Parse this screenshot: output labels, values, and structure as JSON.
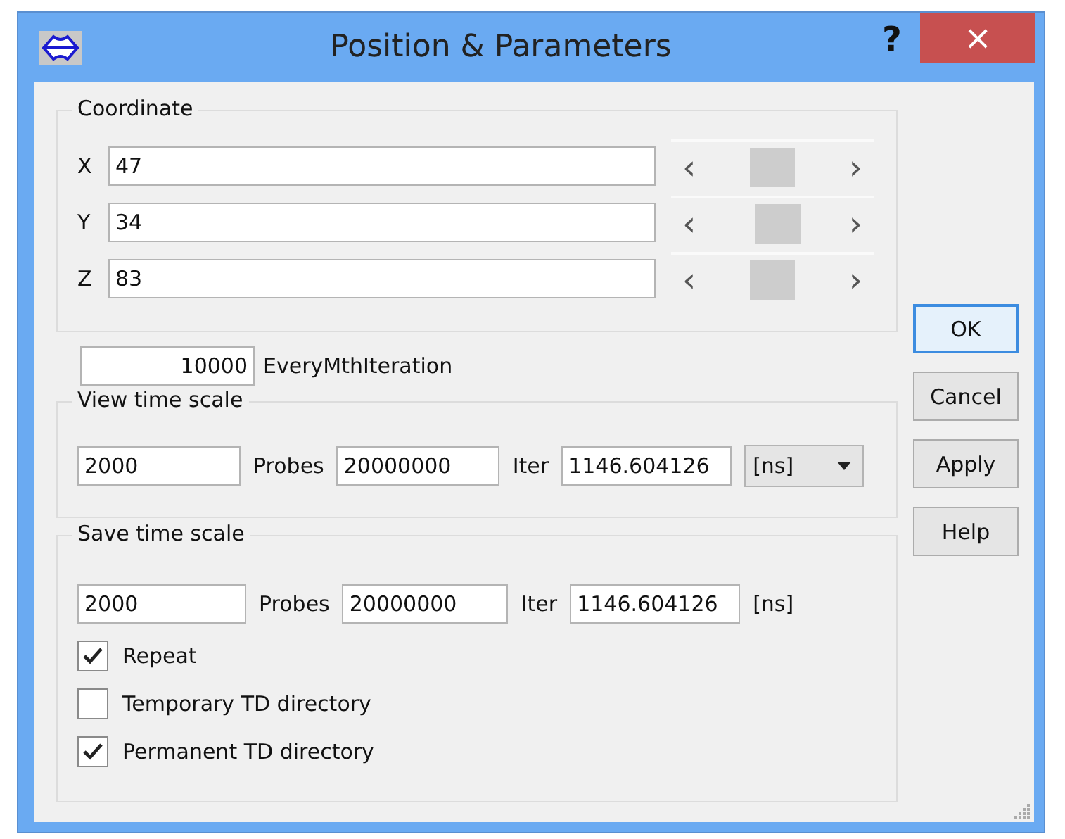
{
  "window": {
    "title": "Position & Parameters",
    "help": "?",
    "close": "×"
  },
  "coordinate": {
    "title": "Coordinate",
    "axes": [
      {
        "label": "X",
        "value": "47",
        "prev": "‹",
        "next": "›",
        "level": 0.5
      },
      {
        "label": "Y",
        "value": "34",
        "prev": "‹",
        "next": "›",
        "level": 0.56
      },
      {
        "label": "Z",
        "value": "83",
        "prev": "‹",
        "next": "›",
        "level": 0.5
      }
    ]
  },
  "iteration": {
    "value": "10000",
    "label": "EveryMthIteration"
  },
  "view_time_scale": {
    "title": "View time scale",
    "time": "2000",
    "probes_label": "Probes",
    "probes": "20000000",
    "iter_label": "Iter",
    "iter": "1146.604126",
    "unit_dropdown": "[ns]"
  },
  "save_time_scale": {
    "title": "Save time scale",
    "time": "2000",
    "probes_label": "Probes",
    "probes": "20000000",
    "iter_label": "Iter",
    "iter": "1146.604126",
    "unit": "[ns]",
    "options": [
      {
        "label": "Repeat",
        "checked": true
      },
      {
        "label": "Temporary TD directory",
        "checked": false
      },
      {
        "label": "Permanent TD directory",
        "checked": true
      }
    ]
  },
  "buttons": [
    {
      "label": "OK",
      "selected": true
    },
    {
      "label": "Cancel",
      "selected": false
    },
    {
      "label": "Apply",
      "selected": false
    },
    {
      "label": "Help",
      "selected": false
    }
  ]
}
